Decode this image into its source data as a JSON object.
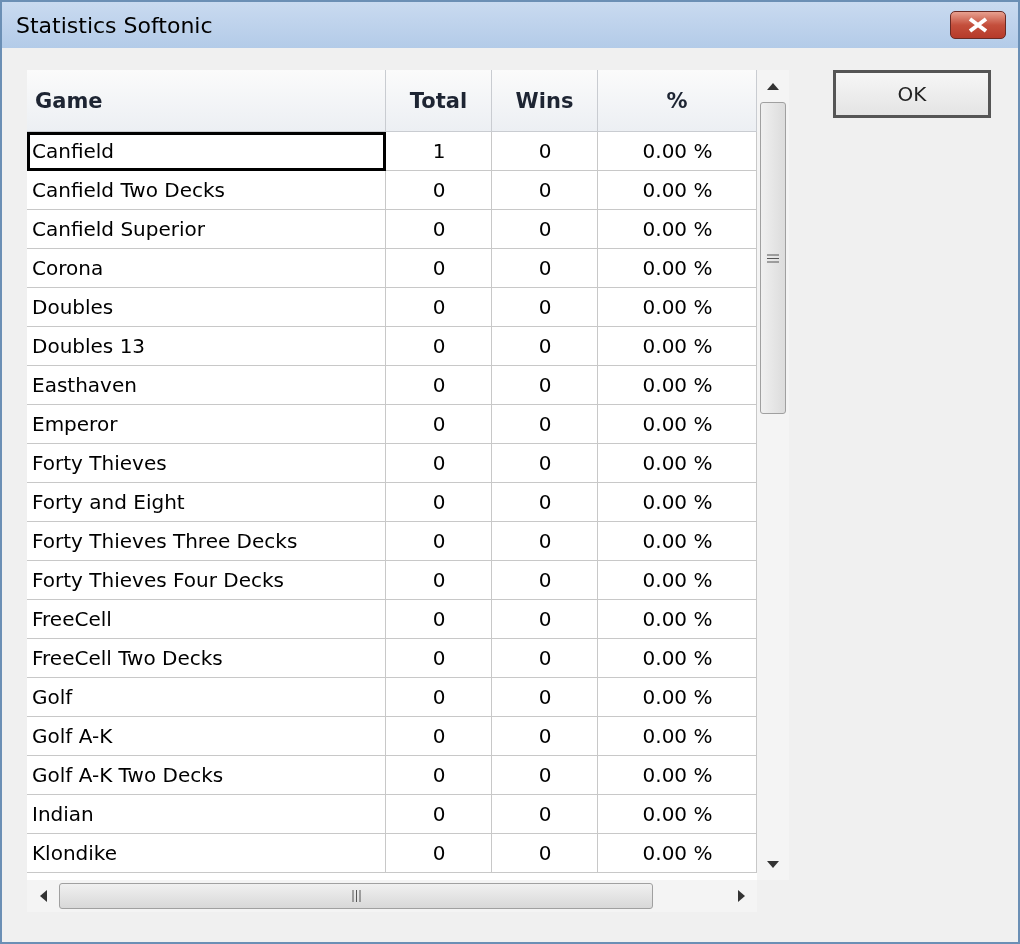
{
  "window": {
    "title": "Statistics Softonic"
  },
  "table": {
    "columns": [
      "Game",
      "Total",
      "Wins",
      "%"
    ],
    "rows": [
      {
        "game": "Canfield",
        "total": "1",
        "wins": "0",
        "percent": "0.00 %",
        "selected": true
      },
      {
        "game": "Canfield Two Decks",
        "total": "0",
        "wins": "0",
        "percent": "0.00 %",
        "selected": false
      },
      {
        "game": "Canfield Superior",
        "total": "0",
        "wins": "0",
        "percent": "0.00 %",
        "selected": false
      },
      {
        "game": "Corona",
        "total": "0",
        "wins": "0",
        "percent": "0.00 %",
        "selected": false
      },
      {
        "game": "Doubles",
        "total": "0",
        "wins": "0",
        "percent": "0.00 %",
        "selected": false
      },
      {
        "game": "Doubles 13",
        "total": "0",
        "wins": "0",
        "percent": "0.00 %",
        "selected": false
      },
      {
        "game": "Easthaven",
        "total": "0",
        "wins": "0",
        "percent": "0.00 %",
        "selected": false
      },
      {
        "game": "Emperor",
        "total": "0",
        "wins": "0",
        "percent": "0.00 %",
        "selected": false
      },
      {
        "game": "Forty Thieves",
        "total": "0",
        "wins": "0",
        "percent": "0.00 %",
        "selected": false
      },
      {
        "game": "Forty and Eight",
        "total": "0",
        "wins": "0",
        "percent": "0.00 %",
        "selected": false
      },
      {
        "game": "Forty Thieves Three Decks",
        "total": "0",
        "wins": "0",
        "percent": "0.00 %",
        "selected": false
      },
      {
        "game": "Forty Thieves Four Decks",
        "total": "0",
        "wins": "0",
        "percent": "0.00 %",
        "selected": false
      },
      {
        "game": "FreeCell",
        "total": "0",
        "wins": "0",
        "percent": "0.00 %",
        "selected": false
      },
      {
        "game": "FreeCell Two Decks",
        "total": "0",
        "wins": "0",
        "percent": "0.00 %",
        "selected": false
      },
      {
        "game": "Golf",
        "total": "0",
        "wins": "0",
        "percent": "0.00 %",
        "selected": false
      },
      {
        "game": "Golf A-K",
        "total": "0",
        "wins": "0",
        "percent": "0.00 %",
        "selected": false
      },
      {
        "game": "Golf A-K Two Decks",
        "total": "0",
        "wins": "0",
        "percent": "0.00 %",
        "selected": false
      },
      {
        "game": "Indian",
        "total": "0",
        "wins": "0",
        "percent": "0.00 %",
        "selected": false
      },
      {
        "game": "Klondike",
        "total": "0",
        "wins": "0",
        "percent": "0.00 %",
        "selected": false
      }
    ]
  },
  "buttons": {
    "ok": "OK"
  }
}
